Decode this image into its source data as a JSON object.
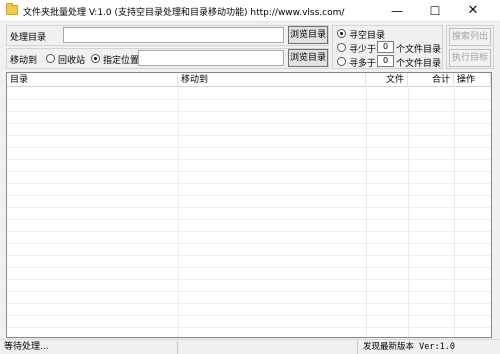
{
  "window": {
    "title": "文件夹批量处理 V:1.0 (支持空目录处理和目录移动功能) http://www.vlss.com/",
    "minimize_glyph": "—",
    "maximize_glyph": "☐",
    "close_glyph": "✕"
  },
  "source": {
    "label": "处理目录",
    "value": "",
    "browse_label": "浏览目录"
  },
  "move": {
    "label": "移动到",
    "option_recycle": "回收站",
    "option_folder": "指定位置",
    "selected": "指定位置",
    "value": "",
    "browse_label": "浏览目录"
  },
  "filter": {
    "option_empty": "寻空目录",
    "option_less_prefix": "寻少于",
    "option_more_prefix": "寻多于",
    "less_value": "0",
    "more_value": "0",
    "suffix": "个文件目录",
    "selected": "寻空目录"
  },
  "actions": {
    "search_label": "搜索列出",
    "execute_label": "执行目标"
  },
  "table": {
    "columns": [
      "目录",
      "移动到",
      "文件",
      "合计",
      "操作"
    ],
    "rows": []
  },
  "status": {
    "left": "等待处理...",
    "middle": "",
    "right": "发现最新版本 Ver:1.0"
  }
}
